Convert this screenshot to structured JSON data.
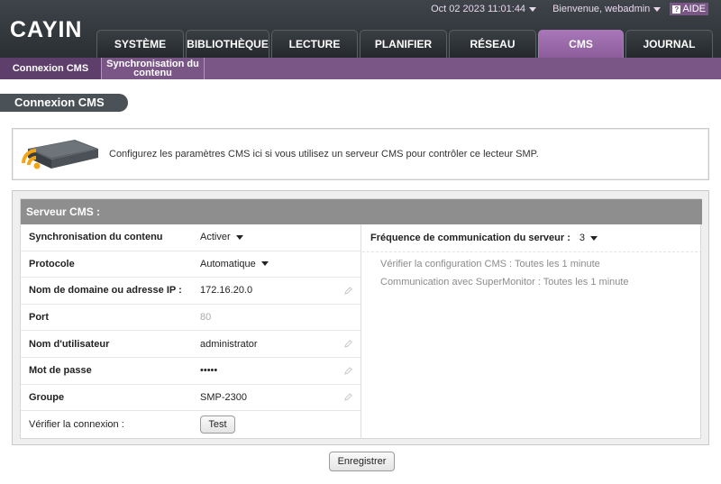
{
  "brand": {
    "logo_text": "CAYIN",
    "accent": "#7a5687",
    "tab_active": "#a877b7"
  },
  "topbar": {
    "datetime": "Oct 02 2023 11:01:44",
    "welcome": "Bienvenue, webadmin",
    "help_label": "AIDE"
  },
  "tabs": [
    {
      "label": "SYSTÈME",
      "active": false
    },
    {
      "label": "BIBLIOTHÈQUE",
      "active": false
    },
    {
      "label": "LECTURE",
      "active": false
    },
    {
      "label": "PLANIFIER",
      "active": false
    },
    {
      "label": "RÉSEAU",
      "active": false
    },
    {
      "label": "CMS",
      "active": true
    },
    {
      "label": "JOURNAL",
      "active": false
    }
  ],
  "subnav": [
    {
      "label": "Connexion CMS",
      "active": true
    },
    {
      "label": "Synchronisation du contenu",
      "active": false
    }
  ],
  "page_title": "Connexion CMS",
  "info_text": "Configurez les paramètres CMS ici si vous utilisez un serveur CMS pour contrôler ce lecteur SMP.",
  "server": {
    "heading": "Serveur CMS :",
    "fields": {
      "sync": {
        "label": "Synchronisation du contenu",
        "value": "Activer"
      },
      "protocol": {
        "label": "Protocole",
        "value": "Automatique"
      },
      "domain": {
        "label": "Nom de domaine ou adresse IP :",
        "value": "172.16.20.0"
      },
      "port": {
        "label": "Port",
        "value": "80"
      },
      "username": {
        "label": "Nom d'utilisateur",
        "value": "administrator"
      },
      "password": {
        "label": "Mot de passe",
        "value": "•••••"
      },
      "group": {
        "label": "Groupe",
        "value": "SMP-2300"
      },
      "verify": {
        "label": "Vérifier la connexion :",
        "button": "Test"
      }
    },
    "frequency": {
      "label": "Fréquence de communication du serveur :",
      "value": "3",
      "check_cms": "Vérifier la configuration CMS : Toutes les 1 minute",
      "supermonitor": "Communication avec SuperMonitor : Toutes les 1 minute"
    }
  },
  "save_label": "Enregistrer"
}
